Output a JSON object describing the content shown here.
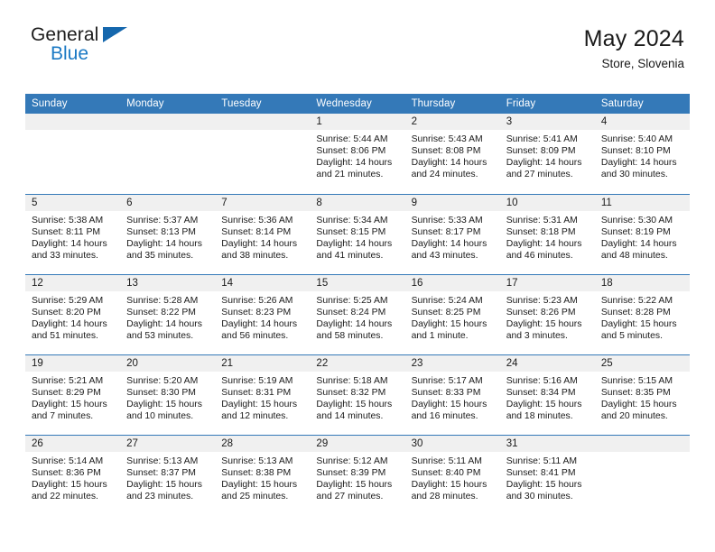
{
  "brand": {
    "name_part1": "General",
    "name_part2": "Blue",
    "flag_icon": "blue-triangle-flag-icon"
  },
  "header": {
    "title": "May 2024",
    "subtitle": "Store, Slovenia"
  },
  "colors": {
    "header_blue": "#3479b8",
    "brand_blue": "#1b79c4",
    "daynum_band": "#f0f0f0",
    "text": "#1a1a1a"
  },
  "weekday_headers": [
    "Sunday",
    "Monday",
    "Tuesday",
    "Wednesday",
    "Thursday",
    "Friday",
    "Saturday"
  ],
  "labels": {
    "sunrise_prefix": "Sunrise:",
    "sunset_prefix": "Sunset:",
    "daylight_prefix": "Daylight:"
  },
  "weeks": [
    [
      {
        "day": "",
        "empty": true,
        "line1": "",
        "line2": "",
        "line3": "",
        "line4": ""
      },
      {
        "day": "",
        "empty": true,
        "line1": "",
        "line2": "",
        "line3": "",
        "line4": ""
      },
      {
        "day": "",
        "empty": true,
        "line1": "",
        "line2": "",
        "line3": "",
        "line4": ""
      },
      {
        "day": "1",
        "empty": false,
        "line1": "Sunrise: 5:44 AM",
        "line2": "Sunset: 8:06 PM",
        "line3": "Daylight: 14 hours",
        "line4": "and 21 minutes."
      },
      {
        "day": "2",
        "empty": false,
        "line1": "Sunrise: 5:43 AM",
        "line2": "Sunset: 8:08 PM",
        "line3": "Daylight: 14 hours",
        "line4": "and 24 minutes."
      },
      {
        "day": "3",
        "empty": false,
        "line1": "Sunrise: 5:41 AM",
        "line2": "Sunset: 8:09 PM",
        "line3": "Daylight: 14 hours",
        "line4": "and 27 minutes."
      },
      {
        "day": "4",
        "empty": false,
        "line1": "Sunrise: 5:40 AM",
        "line2": "Sunset: 8:10 PM",
        "line3": "Daylight: 14 hours",
        "line4": "and 30 minutes."
      }
    ],
    [
      {
        "day": "5",
        "empty": false,
        "line1": "Sunrise: 5:38 AM",
        "line2": "Sunset: 8:11 PM",
        "line3": "Daylight: 14 hours",
        "line4": "and 33 minutes."
      },
      {
        "day": "6",
        "empty": false,
        "line1": "Sunrise: 5:37 AM",
        "line2": "Sunset: 8:13 PM",
        "line3": "Daylight: 14 hours",
        "line4": "and 35 minutes."
      },
      {
        "day": "7",
        "empty": false,
        "line1": "Sunrise: 5:36 AM",
        "line2": "Sunset: 8:14 PM",
        "line3": "Daylight: 14 hours",
        "line4": "and 38 minutes."
      },
      {
        "day": "8",
        "empty": false,
        "line1": "Sunrise: 5:34 AM",
        "line2": "Sunset: 8:15 PM",
        "line3": "Daylight: 14 hours",
        "line4": "and 41 minutes."
      },
      {
        "day": "9",
        "empty": false,
        "line1": "Sunrise: 5:33 AM",
        "line2": "Sunset: 8:17 PM",
        "line3": "Daylight: 14 hours",
        "line4": "and 43 minutes."
      },
      {
        "day": "10",
        "empty": false,
        "line1": "Sunrise: 5:31 AM",
        "line2": "Sunset: 8:18 PM",
        "line3": "Daylight: 14 hours",
        "line4": "and 46 minutes."
      },
      {
        "day": "11",
        "empty": false,
        "line1": "Sunrise: 5:30 AM",
        "line2": "Sunset: 8:19 PM",
        "line3": "Daylight: 14 hours",
        "line4": "and 48 minutes."
      }
    ],
    [
      {
        "day": "12",
        "empty": false,
        "line1": "Sunrise: 5:29 AM",
        "line2": "Sunset: 8:20 PM",
        "line3": "Daylight: 14 hours",
        "line4": "and 51 minutes."
      },
      {
        "day": "13",
        "empty": false,
        "line1": "Sunrise: 5:28 AM",
        "line2": "Sunset: 8:22 PM",
        "line3": "Daylight: 14 hours",
        "line4": "and 53 minutes."
      },
      {
        "day": "14",
        "empty": false,
        "line1": "Sunrise: 5:26 AM",
        "line2": "Sunset: 8:23 PM",
        "line3": "Daylight: 14 hours",
        "line4": "and 56 minutes."
      },
      {
        "day": "15",
        "empty": false,
        "line1": "Sunrise: 5:25 AM",
        "line2": "Sunset: 8:24 PM",
        "line3": "Daylight: 14 hours",
        "line4": "and 58 minutes."
      },
      {
        "day": "16",
        "empty": false,
        "line1": "Sunrise: 5:24 AM",
        "line2": "Sunset: 8:25 PM",
        "line3": "Daylight: 15 hours",
        "line4": "and 1 minute."
      },
      {
        "day": "17",
        "empty": false,
        "line1": "Sunrise: 5:23 AM",
        "line2": "Sunset: 8:26 PM",
        "line3": "Daylight: 15 hours",
        "line4": "and 3 minutes."
      },
      {
        "day": "18",
        "empty": false,
        "line1": "Sunrise: 5:22 AM",
        "line2": "Sunset: 8:28 PM",
        "line3": "Daylight: 15 hours",
        "line4": "and 5 minutes."
      }
    ],
    [
      {
        "day": "19",
        "empty": false,
        "line1": "Sunrise: 5:21 AM",
        "line2": "Sunset: 8:29 PM",
        "line3": "Daylight: 15 hours",
        "line4": "and 7 minutes."
      },
      {
        "day": "20",
        "empty": false,
        "line1": "Sunrise: 5:20 AM",
        "line2": "Sunset: 8:30 PM",
        "line3": "Daylight: 15 hours",
        "line4": "and 10 minutes."
      },
      {
        "day": "21",
        "empty": false,
        "line1": "Sunrise: 5:19 AM",
        "line2": "Sunset: 8:31 PM",
        "line3": "Daylight: 15 hours",
        "line4": "and 12 minutes."
      },
      {
        "day": "22",
        "empty": false,
        "line1": "Sunrise: 5:18 AM",
        "line2": "Sunset: 8:32 PM",
        "line3": "Daylight: 15 hours",
        "line4": "and 14 minutes."
      },
      {
        "day": "23",
        "empty": false,
        "line1": "Sunrise: 5:17 AM",
        "line2": "Sunset: 8:33 PM",
        "line3": "Daylight: 15 hours",
        "line4": "and 16 minutes."
      },
      {
        "day": "24",
        "empty": false,
        "line1": "Sunrise: 5:16 AM",
        "line2": "Sunset: 8:34 PM",
        "line3": "Daylight: 15 hours",
        "line4": "and 18 minutes."
      },
      {
        "day": "25",
        "empty": false,
        "line1": "Sunrise: 5:15 AM",
        "line2": "Sunset: 8:35 PM",
        "line3": "Daylight: 15 hours",
        "line4": "and 20 minutes."
      }
    ],
    [
      {
        "day": "26",
        "empty": false,
        "line1": "Sunrise: 5:14 AM",
        "line2": "Sunset: 8:36 PM",
        "line3": "Daylight: 15 hours",
        "line4": "and 22 minutes."
      },
      {
        "day": "27",
        "empty": false,
        "line1": "Sunrise: 5:13 AM",
        "line2": "Sunset: 8:37 PM",
        "line3": "Daylight: 15 hours",
        "line4": "and 23 minutes."
      },
      {
        "day": "28",
        "empty": false,
        "line1": "Sunrise: 5:13 AM",
        "line2": "Sunset: 8:38 PM",
        "line3": "Daylight: 15 hours",
        "line4": "and 25 minutes."
      },
      {
        "day": "29",
        "empty": false,
        "line1": "Sunrise: 5:12 AM",
        "line2": "Sunset: 8:39 PM",
        "line3": "Daylight: 15 hours",
        "line4": "and 27 minutes."
      },
      {
        "day": "30",
        "empty": false,
        "line1": "Sunrise: 5:11 AM",
        "line2": "Sunset: 8:40 PM",
        "line3": "Daylight: 15 hours",
        "line4": "and 28 minutes."
      },
      {
        "day": "31",
        "empty": false,
        "line1": "Sunrise: 5:11 AM",
        "line2": "Sunset: 8:41 PM",
        "line3": "Daylight: 15 hours",
        "line4": "and 30 minutes."
      },
      {
        "day": "",
        "empty": true,
        "line1": "",
        "line2": "",
        "line3": "",
        "line4": ""
      }
    ]
  ]
}
